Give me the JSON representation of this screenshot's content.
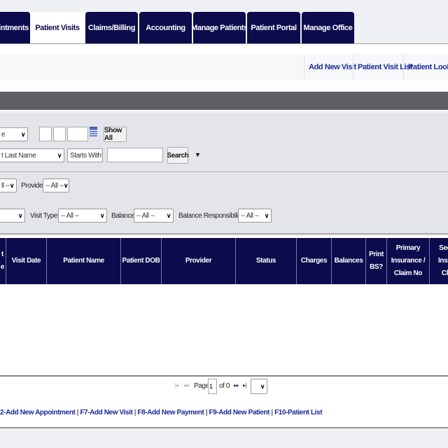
{
  "tabs": [
    {
      "label": "intments",
      "active": false
    },
    {
      "label": "Patient Visits",
      "active": true
    },
    {
      "label": "Claims/Billing",
      "active": false
    },
    {
      "label": "Accounting",
      "active": false
    },
    {
      "label": "Manage Patients",
      "active": false
    },
    {
      "label": "Patient Portal",
      "active": false
    },
    {
      "label": "Manage Office",
      "active": false
    }
  ],
  "subnav": [
    "Add New Visit",
    "Patient Visit List",
    "Patient Look Up"
  ],
  "filters": {
    "date_select": "e",
    "show_all": "Show All",
    "search_field": "t Last Name",
    "match_mode": "Starts With",
    "search_value": "",
    "search_button": "Search",
    "row2_first": "ll --",
    "provider_label": "Provider:",
    "provider_value": "-- All --",
    "row3_first": "",
    "visit_type_label": "Visit Type:",
    "visit_type_value": "-- All --",
    "balance_label": "Balance:",
    "balance_value": "-- All --",
    "balance_resp_label": "Balance Responsibility:",
    "balance_resp_value": "-- All --"
  },
  "table": {
    "columns": [
      "t\ne",
      "Visit Date",
      "Patient Name",
      "Patient DOB",
      "Provider",
      "Status",
      "Charges",
      "Balances",
      "Print BS?",
      "Primary Insurance / Claim No",
      "Sec Insu Cl"
    ],
    "rows": []
  },
  "pager": {
    "page_label": "Page",
    "page": "1",
    "of_label": "of 0"
  },
  "shortcuts": [
    "2-Add New Appointment",
    "F7-Add New Visit",
    "F8-Add New Payment",
    "F9-Add New Patient",
    "F10-Patient List"
  ],
  "colors": {
    "navy": "#0b0b4d",
    "link": "#1a2a9a",
    "bar": "#5f6066"
  }
}
